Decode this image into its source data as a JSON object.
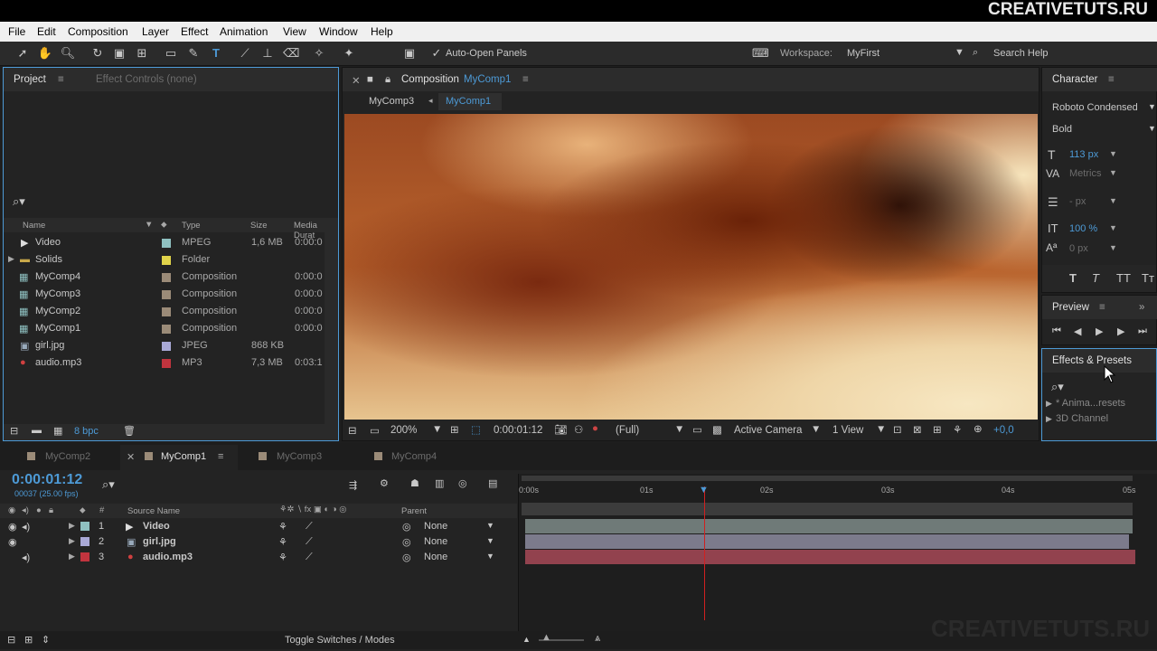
{
  "brand": "CREATIVETUTS.RU",
  "watermark": "CREATIVETUTS.RU",
  "menu": [
    "File",
    "Edit",
    "Composition",
    "Layer",
    "Effect",
    "Animation",
    "View",
    "Window",
    "Help"
  ],
  "toolbar": {
    "auto_open": "Auto-Open Panels",
    "workspace_label": "Workspace:",
    "workspace_value": "MyFirst",
    "search_help": "Search Help"
  },
  "project": {
    "tab_project": "Project",
    "tab_effect_controls": "Effect Controls (none)",
    "columns": {
      "name": "Name",
      "type": "Type",
      "size": "Size",
      "duration": "Media Durat"
    },
    "items": [
      {
        "name": "Video",
        "type": "MPEG",
        "size": "1,6 MB",
        "duration": "0:00:0",
        "color": "#8fc1c1"
      },
      {
        "name": "Solids",
        "type": "Folder",
        "size": "",
        "duration": "",
        "color": "#e0d34a"
      },
      {
        "name": "MyComp4",
        "type": "Composition",
        "size": "",
        "duration": "0:00:0",
        "color": "#9b8b78"
      },
      {
        "name": "MyComp3",
        "type": "Composition",
        "size": "",
        "duration": "0:00:0",
        "color": "#9b8b78"
      },
      {
        "name": "MyComp2",
        "type": "Composition",
        "size": "",
        "duration": "0:00:0",
        "color": "#9b8b78"
      },
      {
        "name": "MyComp1",
        "type": "Composition",
        "size": "",
        "duration": "0:00:0",
        "color": "#9b8b78"
      },
      {
        "name": "girl.jpg",
        "type": "JPEG",
        "size": "868 KB",
        "duration": "",
        "color": "#a9a9d6"
      },
      {
        "name": "audio.mp3",
        "type": "MP3",
        "size": "7,3 MB",
        "duration": "0:03:1",
        "color": "#c1343e"
      }
    ],
    "bpc": "8 bpc"
  },
  "composition": {
    "title_prefix": "Composition",
    "title_name": "MyComp1",
    "nav": [
      "MyComp3",
      "MyComp1"
    ],
    "footer": {
      "zoom": "200%",
      "timecode": "0:00:01:12",
      "resolution": "(Full)",
      "camera": "Active Camera",
      "view": "1 View",
      "exposure": "+0,0"
    }
  },
  "character": {
    "title": "Character",
    "font": "Roboto Condensed",
    "style": "Bold",
    "size": "113 px",
    "kerning": "Metrics",
    "leading": "- px",
    "vscale": "100 %",
    "baseline": "0 px",
    "styles": [
      "T",
      "T",
      "TT",
      "Tт"
    ]
  },
  "preview": {
    "title": "Preview"
  },
  "effects": {
    "title": "Effects & Presets",
    "items": [
      "* Anima...resets",
      "3D Channel"
    ]
  },
  "timeline": {
    "tabs": [
      "MyComp2",
      "MyComp1",
      "MyComp3",
      "MyComp4"
    ],
    "active_tab": "MyComp1",
    "timecode": "0:00:01:12",
    "frames": "00037 (25.00 fps)",
    "col_source": "Source Name",
    "col_parent": "Parent",
    "ruler": [
      "0:00s",
      "01s",
      "02s",
      "03s",
      "04s",
      "05s"
    ],
    "layers": [
      {
        "num": "1",
        "name": "Video",
        "parent": "None",
        "color": "#8fc1c1",
        "bar": "#6f7a78"
      },
      {
        "num": "2",
        "name": "girl.jpg",
        "parent": "None",
        "color": "#a9a9d6",
        "bar": "#7c7b8c"
      },
      {
        "num": "3",
        "name": "audio.mp3",
        "parent": "None",
        "color": "#c1343e",
        "bar": "#92424e"
      }
    ],
    "toggle": "Toggle Switches / Modes"
  }
}
